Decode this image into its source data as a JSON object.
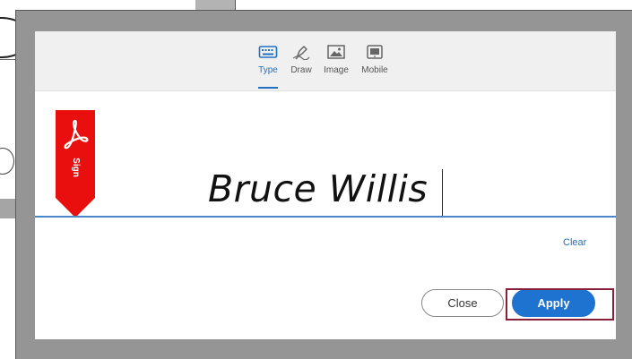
{
  "tabs": [
    {
      "label": "Type",
      "icon": "keyboard-icon",
      "active": true
    },
    {
      "label": "Draw",
      "icon": "pen-icon",
      "active": false
    },
    {
      "label": "Image",
      "icon": "image-icon",
      "active": false
    },
    {
      "label": "Mobile",
      "icon": "mobile-icon",
      "active": false
    }
  ],
  "ribbon": {
    "label": "Sign",
    "icon": "acrobat-icon",
    "color": "#ea0f0f"
  },
  "signature": {
    "value": "Bruce Willis"
  },
  "actions": {
    "clear_label": "Clear",
    "close_label": "Close",
    "apply_label": "Apply"
  },
  "colors": {
    "accent": "#1f70c1",
    "ribbon": "#ea0f0f",
    "highlight": "#8a1e3a"
  }
}
